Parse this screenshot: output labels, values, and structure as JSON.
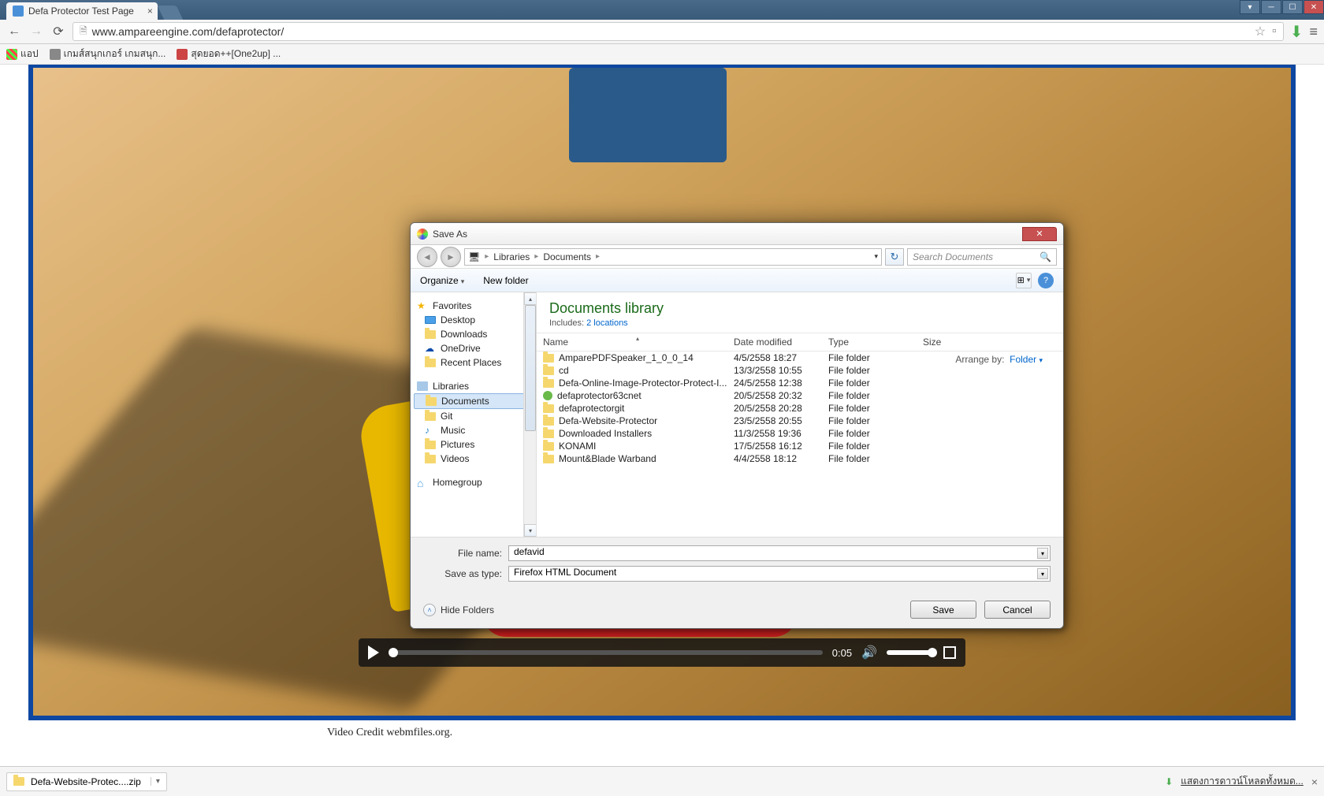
{
  "browser": {
    "tab_title": "Defa Protector Test Page",
    "url": "www.ampareengine.com/defaprotector/",
    "bookmarks": [
      "แอป",
      "เกมส์สนุกเกอร์ เกมสนุก...",
      "สุดยอด++[One2up] ..."
    ]
  },
  "video": {
    "time": "0:05",
    "credit": "Video Credit webmfiles.org."
  },
  "dialog": {
    "title": "Save As",
    "breadcrumb": [
      "Libraries",
      "Documents"
    ],
    "search_placeholder": "Search Documents",
    "organize": "Organize",
    "new_folder": "New folder",
    "library_title": "Documents library",
    "includes_label": "Includes:",
    "includes_link": "2 locations",
    "arrange_label": "Arrange by:",
    "arrange_value": "Folder",
    "nav": {
      "favorites": "Favorites",
      "desktop": "Desktop",
      "downloads": "Downloads",
      "onedrive": "OneDrive",
      "recent": "Recent Places",
      "libraries": "Libraries",
      "documents": "Documents",
      "git": "Git",
      "music": "Music",
      "pictures": "Pictures",
      "videos": "Videos",
      "homegroup": "Homegroup"
    },
    "columns": {
      "name": "Name",
      "date": "Date modified",
      "type": "Type",
      "size": "Size"
    },
    "files": [
      {
        "name": "AmparePDFSpeaker_1_0_0_14",
        "date": "4/5/2558 18:27",
        "type": "File folder",
        "icon": "folder"
      },
      {
        "name": "cd",
        "date": "13/3/2558 10:55",
        "type": "File folder",
        "icon": "folder"
      },
      {
        "name": "Defa-Online-Image-Protector-Protect-I...",
        "date": "24/5/2558 12:38",
        "type": "File folder",
        "icon": "folder"
      },
      {
        "name": "defaprotector63cnet",
        "date": "20/5/2558 20:32",
        "type": "File folder",
        "icon": "green"
      },
      {
        "name": "defaprotectorgit",
        "date": "20/5/2558 20:28",
        "type": "File folder",
        "icon": "folder"
      },
      {
        "name": "Defa-Website-Protector",
        "date": "23/5/2558 20:55",
        "type": "File folder",
        "icon": "folder"
      },
      {
        "name": "Downloaded Installers",
        "date": "11/3/2558 19:36",
        "type": "File folder",
        "icon": "folder"
      },
      {
        "name": "KONAMI",
        "date": "17/5/2558 16:12",
        "type": "File folder",
        "icon": "folder"
      },
      {
        "name": "Mount&Blade Warband",
        "date": "4/4/2558 18:12",
        "type": "File folder",
        "icon": "folder"
      }
    ],
    "filename_label": "File name:",
    "filename_value": "defavid",
    "savetype_label": "Save as type:",
    "savetype_value": "Firefox HTML Document",
    "hide_folders": "Hide Folders",
    "save": "Save",
    "cancel": "Cancel"
  },
  "downloadbar": {
    "item": "Defa-Website-Protec....zip",
    "show_all": "แสดงการดาวน์โหลดทั้งหมด..."
  }
}
